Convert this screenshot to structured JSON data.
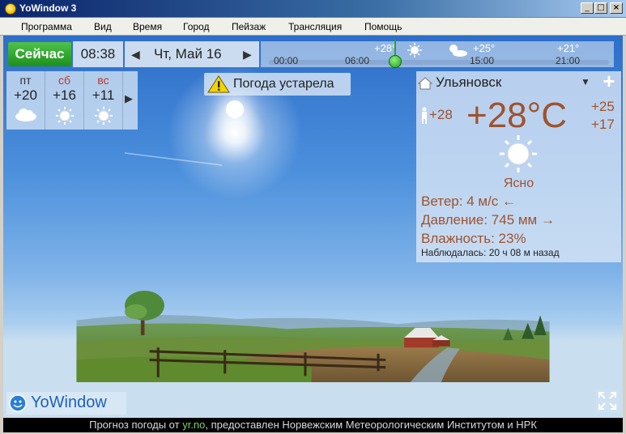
{
  "window": {
    "title": "YoWindow 3"
  },
  "menu": [
    "Программа",
    "Вид",
    "Время",
    "Город",
    "Пейзаж",
    "Трансляция",
    "Помощь"
  ],
  "toolbar": {
    "now_label": "Сейчас",
    "time": "08:38",
    "date": "Чт, Май 16"
  },
  "timeline": {
    "hours": [
      "00:00",
      "06:00",
      "15:00",
      "21:00"
    ],
    "temps": [
      "+28°",
      "+25°",
      "+21°"
    ],
    "current_position_fraction": 0.36
  },
  "forecast": [
    {
      "day": "пт",
      "temp": "+20",
      "icon": "cloud-icon",
      "weekend": false
    },
    {
      "day": "сб",
      "temp": "+16",
      "icon": "sun-icon",
      "weekend": true
    },
    {
      "day": "вс",
      "temp": "+11",
      "icon": "sun-icon",
      "weekend": true
    }
  ],
  "warning": {
    "text": "Погода устарела"
  },
  "current": {
    "city": "Ульяновск",
    "feels_like": "+28",
    "temperature": "+28°C",
    "high": "+25",
    "low": "+17",
    "condition": "Ясно",
    "wind_label": "Ветер:",
    "wind_value": "4 м/с ←",
    "pressure_label": "Давление:",
    "pressure_value": "745 мм →",
    "humidity_label": "Влажность:",
    "humidity_value": "23%",
    "observed_label": "Наблюдалась:",
    "observed_value": "20 ч 08 м назад"
  },
  "brand": {
    "name": "YoWindow"
  },
  "status": {
    "prefix": "Прогноз погоды от ",
    "link": "yr.no",
    "suffix": ", предоставлен Норвежским Метеорологическим Институтом и НРК"
  },
  "colors": {
    "now_button": "#2aa12a",
    "temperature": "#a0522d",
    "weekend": "#c0392b",
    "sky_top": "#2d6ec9"
  }
}
